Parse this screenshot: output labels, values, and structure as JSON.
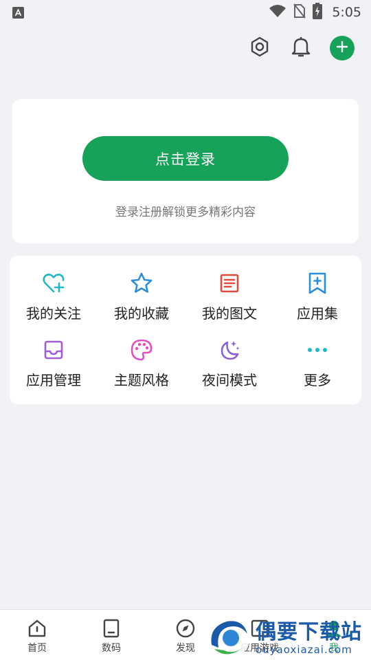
{
  "status_bar": {
    "time": "5:05",
    "left_icon": "a-icon",
    "icons": [
      "wifi-icon",
      "no-sim-icon",
      "battery-charging-icon"
    ]
  },
  "top_actions": {
    "icons": [
      "settings-hex-icon",
      "bell-icon",
      "add-icon"
    ],
    "accent": "#17a25a"
  },
  "login": {
    "button_label": "点击登录",
    "hint": "登录注册解锁更多精彩内容"
  },
  "grid": {
    "items": [
      {
        "label": "我的关注",
        "icon": "heart-plus-icon",
        "color": "#1fb7c9"
      },
      {
        "label": "我的收藏",
        "icon": "star-icon",
        "color": "#2b8de0"
      },
      {
        "label": "我的图文",
        "icon": "article-icon",
        "color": "#e04b3c"
      },
      {
        "label": "应用集",
        "icon": "bookmark-plus-icon",
        "color": "#2b8de0"
      },
      {
        "label": "应用管理",
        "icon": "inbox-icon",
        "color": "#a35bd8"
      },
      {
        "label": "主题风格",
        "icon": "palette-icon",
        "color": "#e04ec0"
      },
      {
        "label": "夜间模式",
        "icon": "moon-stars-icon",
        "color": "#8b5fe0"
      },
      {
        "label": "更多",
        "icon": "more-dots-icon",
        "color": "#1fb7c9"
      }
    ]
  },
  "bottom_nav": {
    "items": [
      {
        "label": "首页",
        "icon": "home-icon"
      },
      {
        "label": "数码",
        "icon": "tablet-icon"
      },
      {
        "label": "发现",
        "icon": "compass-icon"
      },
      {
        "label": "应用游戏",
        "icon": "apps-icon"
      },
      {
        "label": "我",
        "icon": "me-icon",
        "active": true
      }
    ]
  },
  "watermark": {
    "title": "偶要下载站",
    "sub": "ouyaoxiazai.com"
  }
}
